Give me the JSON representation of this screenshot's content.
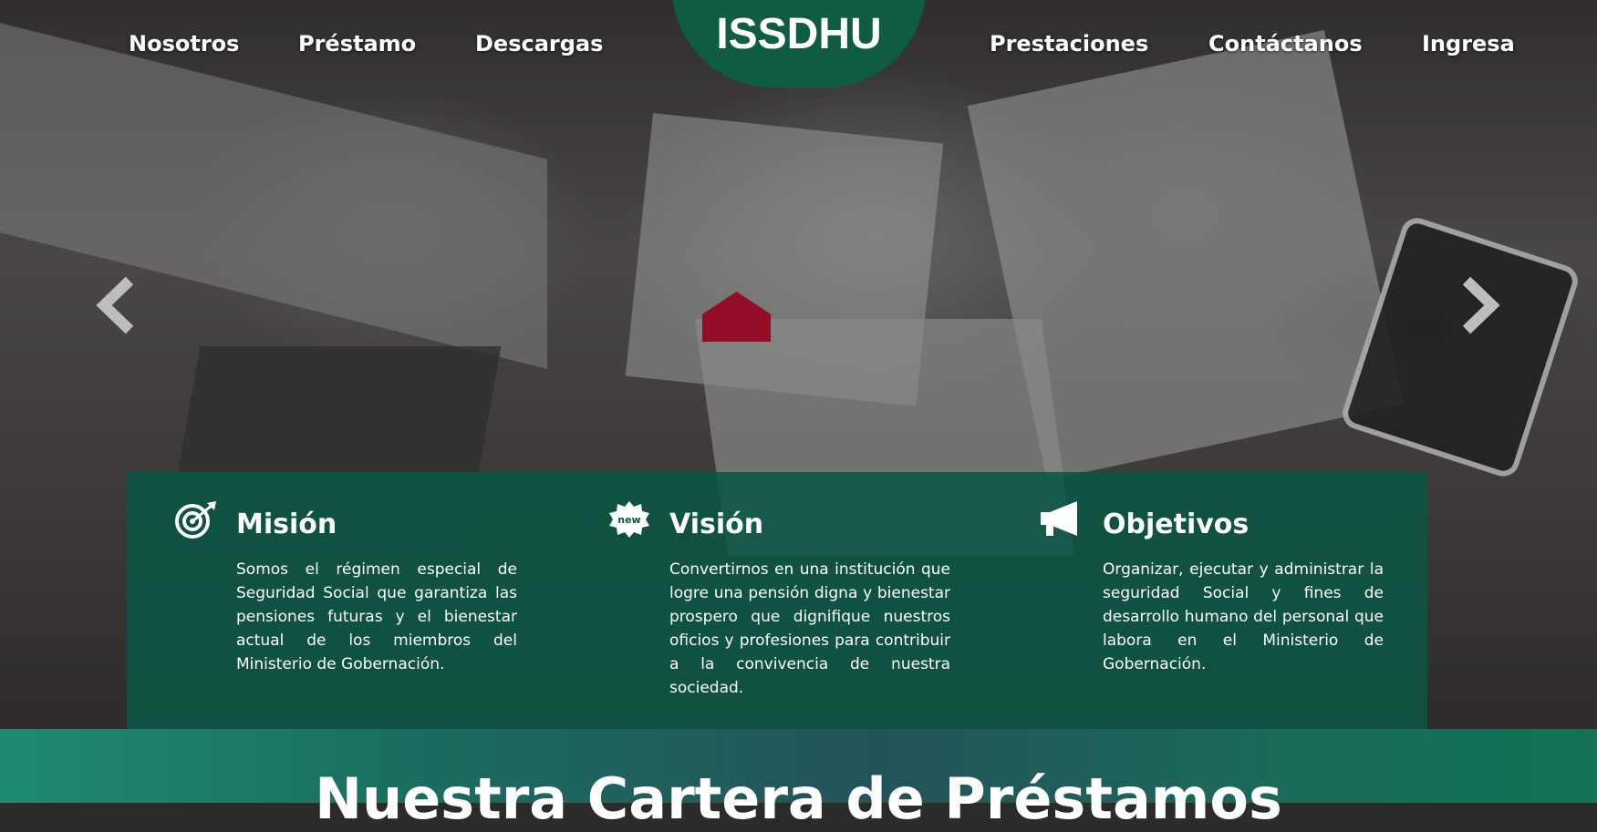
{
  "brand": {
    "logo_text": "ISSDHU",
    "logo_color": "#0e5c44"
  },
  "nav": {
    "left": [
      "Nosotros",
      "Préstamo",
      "Descargas"
    ],
    "right": [
      "Prestaciones",
      "Contáctanos",
      "Ingresa"
    ]
  },
  "carousel": {
    "prev_icon": "chevron-left-icon",
    "next_icon": "chevron-right-icon"
  },
  "info": [
    {
      "icon": "target-icon",
      "title": "Misión",
      "text": "Somos el régimen especial de Seguridad Social que garantiza las pensiones futuras y el bienestar actual de los miembros del Ministerio de Gobernación."
    },
    {
      "icon": "new-badge-icon",
      "badge_text": "new",
      "title": "Visión",
      "text": "Convertirnos en una institución que logre una pensión digna y bienestar prospero que dignifique nuestros oficios y profesiones para contribuir a la convivencia de nuestra sociedad."
    },
    {
      "icon": "megaphone-icon",
      "title": "Objetivos",
      "text": "Organizar, ejecutar y administrar la seguridad Social y fines de desarrollo humano del personal que labora en el Ministerio de Gobernación."
    }
  ],
  "section": {
    "heading": "Nuestra Cartera de Préstamos"
  },
  "colors": {
    "panel": "#0a5544",
    "band_start": "#1f8a73",
    "band_end": "#127358"
  }
}
